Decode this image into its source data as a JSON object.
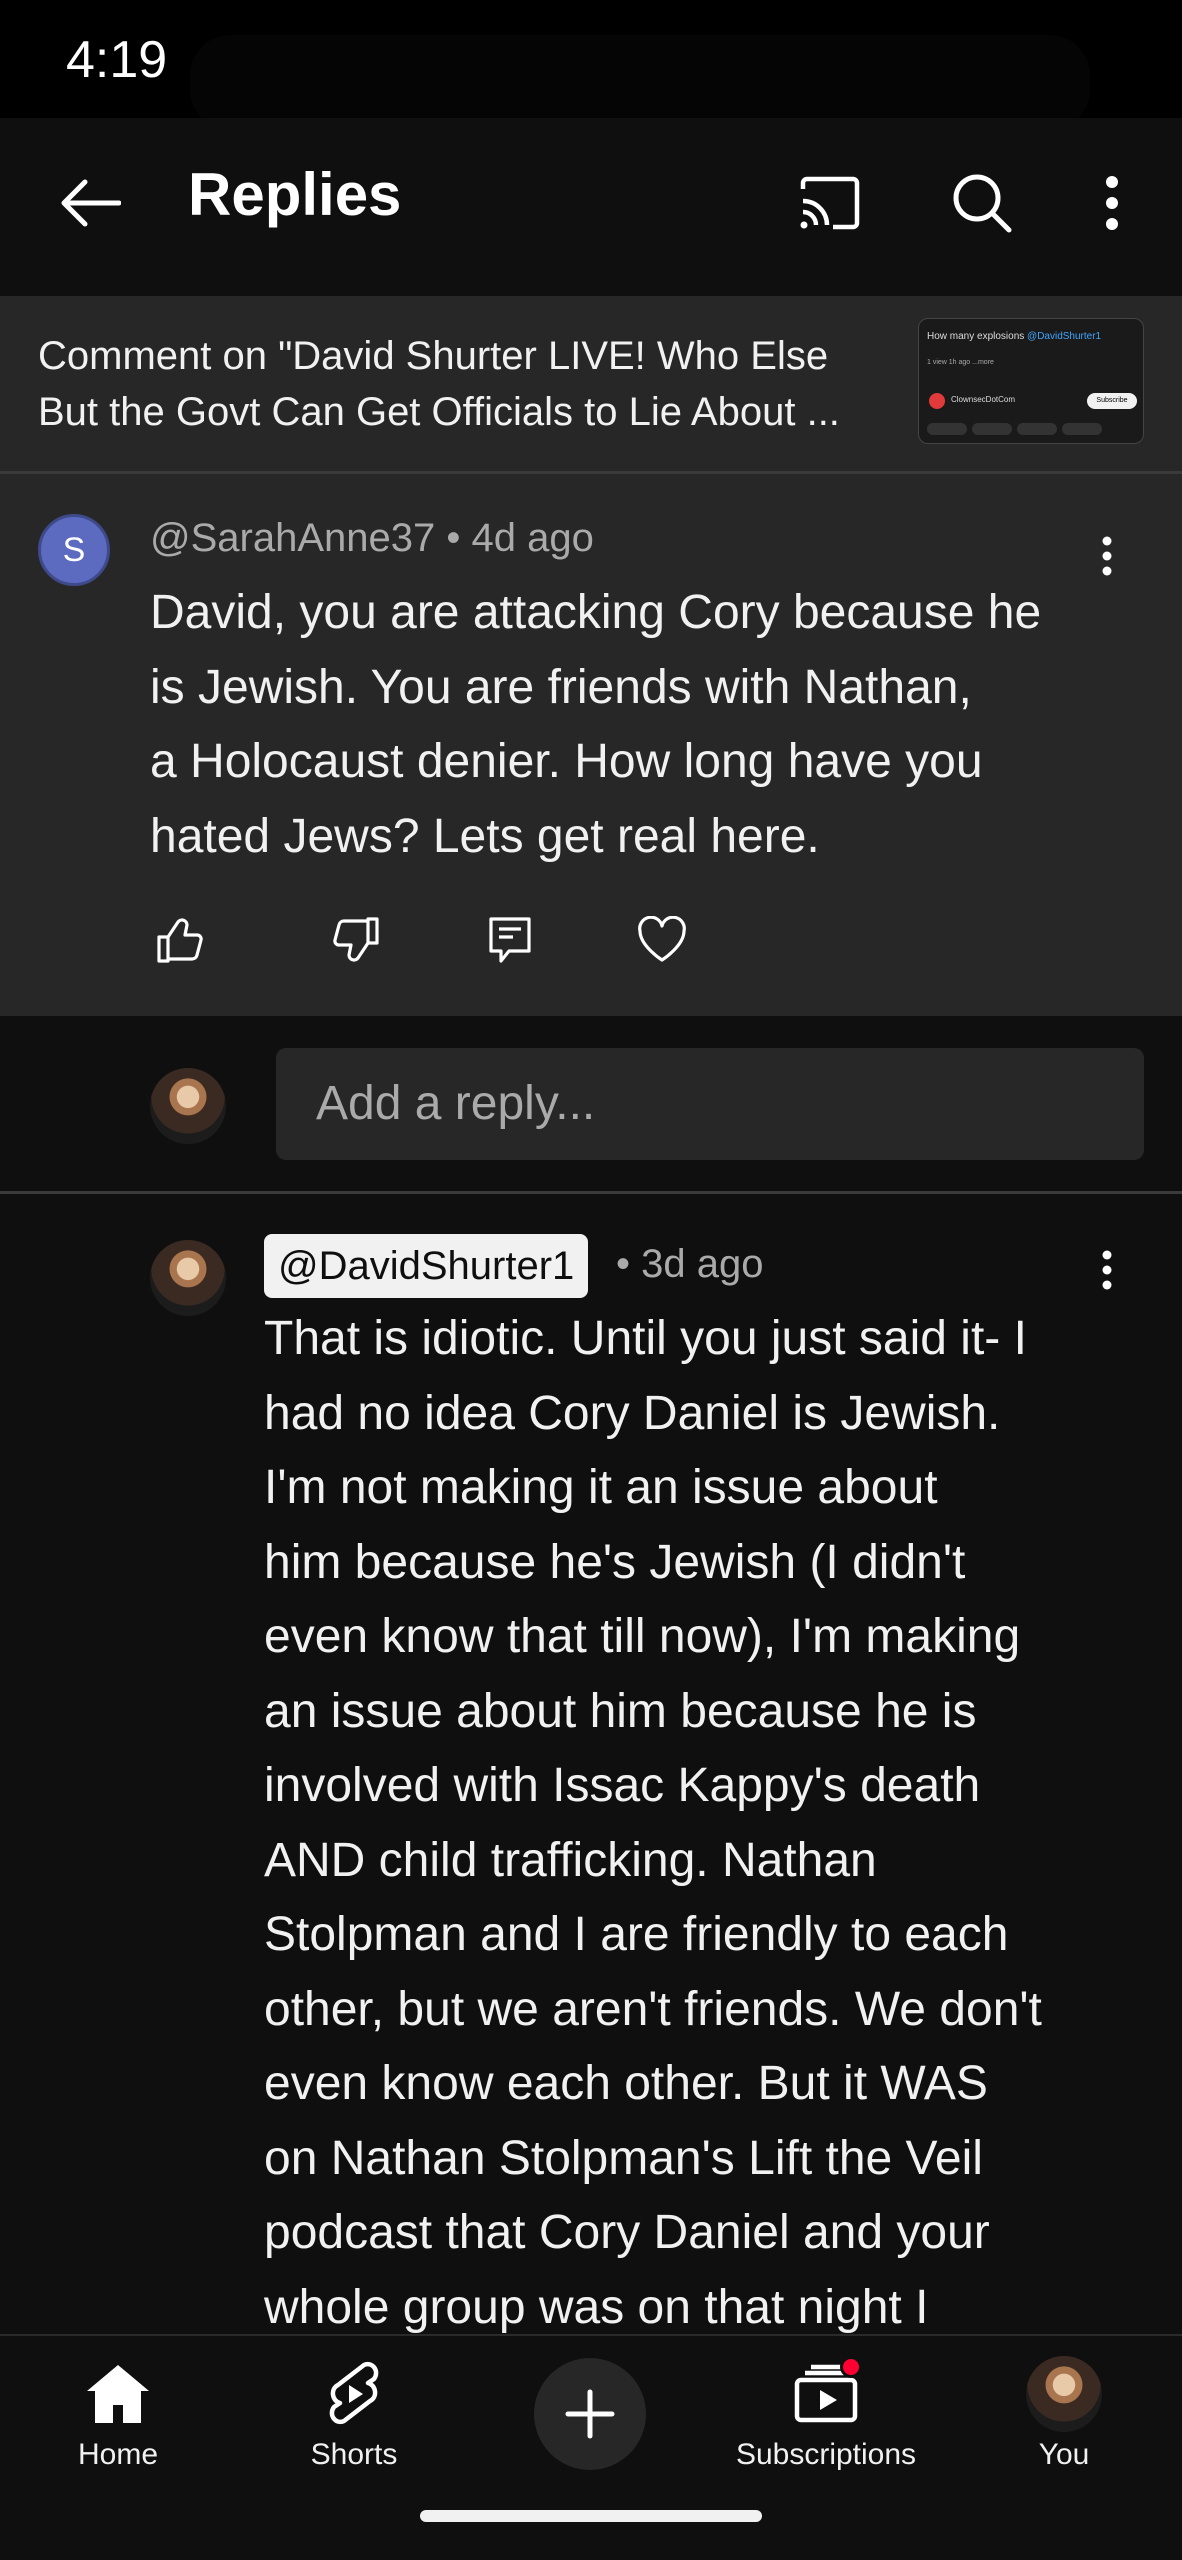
{
  "status_bar": {
    "time": "4:19"
  },
  "header": {
    "title": "Replies"
  },
  "video": {
    "line1": "Comment on \"David Shurter LIVE! Who Else",
    "line2": "But the Govt Can Get Officials to Lie About ...",
    "thumb_title": "How many explosions",
    "thumb_mention": "@DavidShurter1",
    "thumb_views": "1 view  1h ago  ...more",
    "thumb_channel": "ClownsecDotCom",
    "thumb_subscribe": "Subscribe"
  },
  "parent_comment": {
    "avatar_letter": "S",
    "author": "@SarahAnne37",
    "age": "4d ago",
    "lines": [
      "David, you are attacking Cory because he",
      "is Jewish. You are friends with Nathan,",
      "a Holocaust denier. How long have you",
      "hated Jews? Lets get real here."
    ]
  },
  "reply_box": {
    "placeholder": "Add a reply..."
  },
  "reply": {
    "author": "@DavidShurter1",
    "age": "3d ago",
    "lines": [
      "That is idiotic. Until you just said it- I",
      "had no idea Cory Daniel is Jewish.",
      "I'm not making it an issue about",
      "him because he's Jewish (I didn't",
      "even know that till now), I'm making",
      "an issue about him because he is",
      "involved with Issac Kappy's death",
      "AND child trafficking. Nathan",
      "Stolpman and I are friendly to each",
      "other, but we aren't friends. We don't",
      "even know each other. But it WAS",
      "on Nathan Stolpman's Lift the Veil",
      "podcast that Cory Daniel and your",
      "whole group was on that night I"
    ]
  },
  "nav": {
    "home": "Home",
    "shorts": "Shorts",
    "subscriptions": "Subscriptions",
    "you": "You"
  },
  "colors": {
    "background": "#0f0f0f",
    "surface": "#272727",
    "accent_red": "#ff0033",
    "link_blue": "#3ea6ff"
  }
}
